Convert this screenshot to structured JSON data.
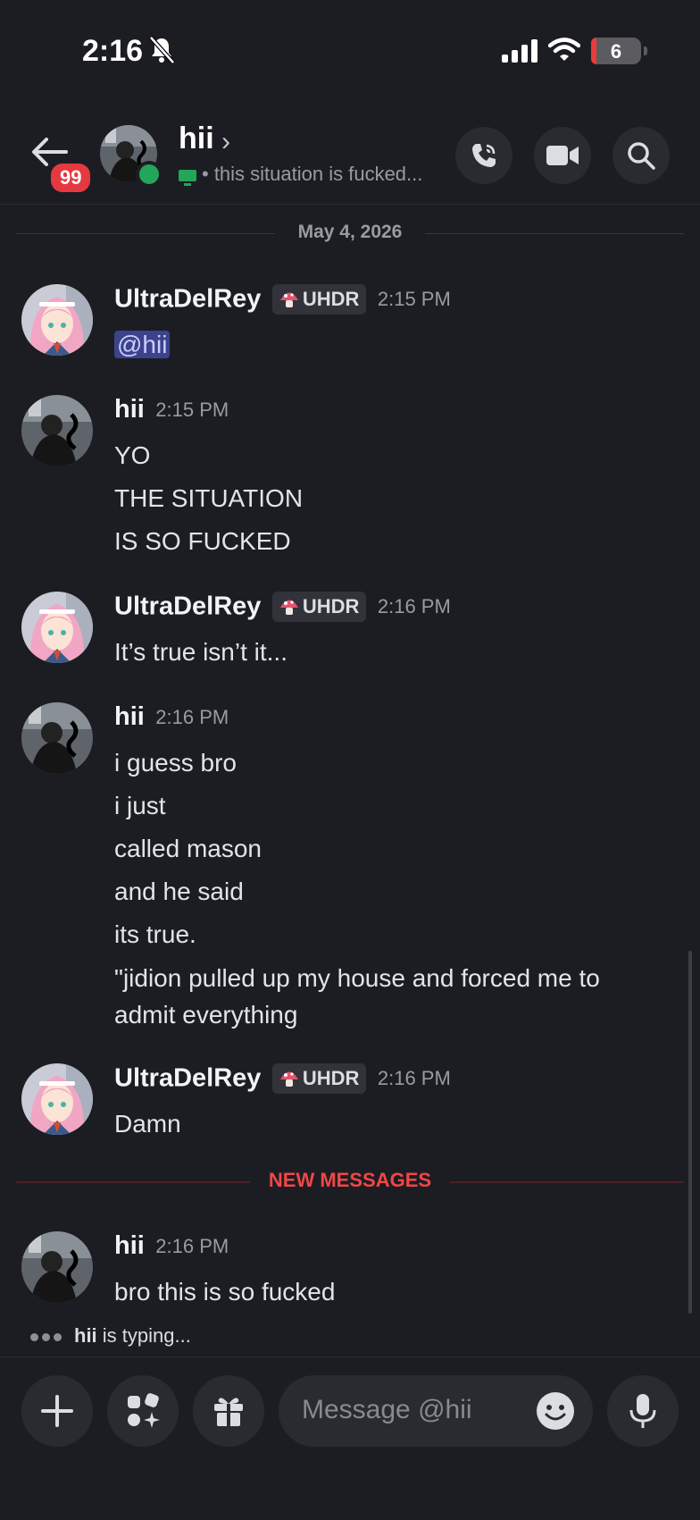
{
  "status_bar": {
    "time": "2:16",
    "battery": "6"
  },
  "header": {
    "unread_count": "99",
    "name": "hii",
    "chevron": "›",
    "status_text": "• this situation is fucked..."
  },
  "date_divider": "May 4, 2026",
  "messages": [
    {
      "author": "UltraDelRey",
      "tag": "UHDR",
      "time": "2:15 PM",
      "mention": "@hii"
    },
    {
      "author": "hii",
      "time": "2:15 PM",
      "lines": [
        "YO",
        "THE SITUATION",
        "IS SO FUCKED"
      ]
    },
    {
      "author": "UltraDelRey",
      "tag": "UHDR",
      "time": "2:16 PM",
      "lines": [
        "It’s true isn’t it..."
      ]
    },
    {
      "author": "hii",
      "time": "2:16 PM",
      "lines": [
        "i guess bro",
        "i just",
        "called mason",
        "and he said",
        "its true.",
        "\"jidion pulled up my house and forced me to admit everything"
      ]
    },
    {
      "author": "UltraDelRey",
      "tag": "UHDR",
      "time": "2:16 PM",
      "lines": [
        "Damn"
      ]
    },
    {
      "author": "hii",
      "time": "2:16 PM",
      "lines": [
        "bro this is so fucked"
      ]
    }
  ],
  "new_messages_label": "NEW MESSAGES",
  "typing": {
    "user": "hii",
    "text": "is typing..."
  },
  "composer": {
    "placeholder": "Message @hii"
  },
  "colors": {
    "background": "#1c1d22",
    "online": "#23a55a",
    "alert": "#e5393f",
    "mention_bg": "#3c428b"
  }
}
